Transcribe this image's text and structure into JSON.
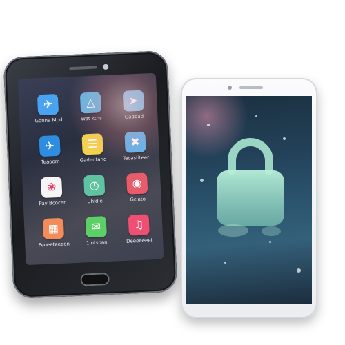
{
  "left_phone": {
    "status_bar": [
      "",
      "",
      "",
      ""
    ],
    "apps": [
      {
        "label": "Gonna Mpd",
        "icon": "bird-icon",
        "color": "#4aa3f0"
      },
      {
        "label": "Wat kths",
        "icon": "triangle-icon",
        "color": "#5bb7e8"
      },
      {
        "label": "Gadbad",
        "icon": "rocket-icon",
        "color": "#6ab8e9"
      },
      {
        "label": "Teaoom",
        "icon": "bird-icon",
        "color": "#2f8de0"
      },
      {
        "label": "Gadentand",
        "icon": "notes-icon",
        "color": "#f2d24e"
      },
      {
        "label": "Tecastiteer",
        "icon": "tools-icon",
        "color": "#5ab4ee"
      },
      {
        "label": "Pay Bcocer",
        "icon": "photos-icon",
        "color": "#f5f5f5"
      },
      {
        "label": "Uhidle",
        "icon": "clock-icon",
        "color": "#5fc3a1"
      },
      {
        "label": "Gclato",
        "icon": "maps-icon",
        "color": "#e75b6b"
      },
      {
        "label": "Feoeeteeeen",
        "icon": "grid-icon",
        "color": "#f48b5a"
      },
      {
        "label": "1 ntspan",
        "icon": "messages-icon",
        "color": "#5cd067"
      },
      {
        "label": "Deeeeeeet",
        "icon": "music-icon",
        "color": "#ef4f73"
      }
    ]
  },
  "right_phone": {
    "lock_icon": "padlock-icon",
    "lock_color": "#9fe0c8"
  }
}
